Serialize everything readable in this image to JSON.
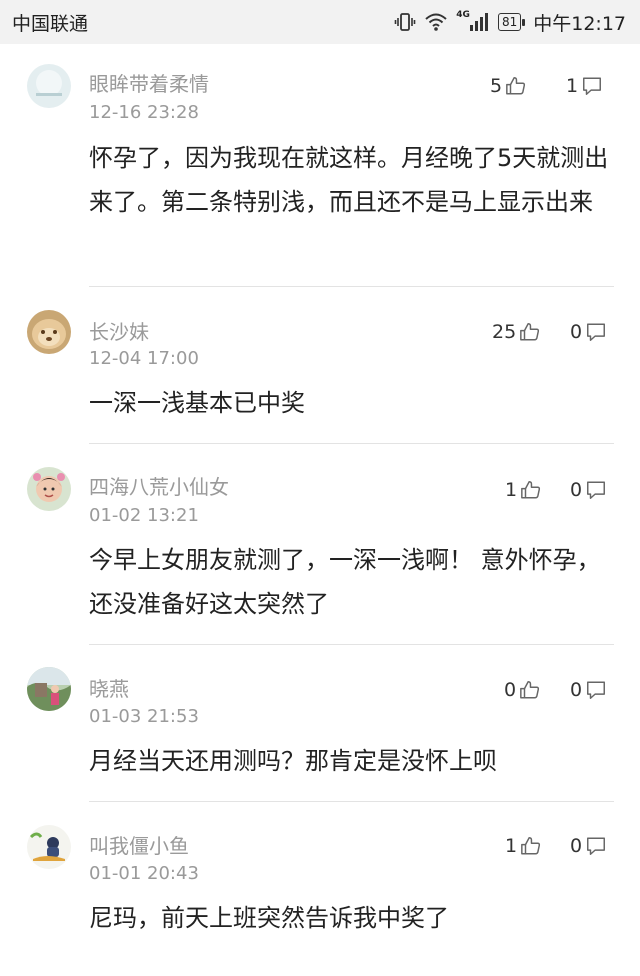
{
  "status": {
    "carrier": "中国联通",
    "network": "4G",
    "battery": "81",
    "time": "中午12:17"
  },
  "comments": [
    {
      "username": "眼眸带着柔情",
      "date": "12-16 23:28",
      "likes": "5",
      "replies": "1",
      "content": "怀孕了，因为我现在就这样。月经晚了5天就测出来了。第二条特别浅，而且还不是马上显示出来"
    },
    {
      "username": "长沙妹",
      "date": "12-04 17:00",
      "likes": "25",
      "replies": "0",
      "content": "一深一浅基本已中奖"
    },
    {
      "username": "四海八荒小仙女",
      "date": "01-02 13:21",
      "likes": "1",
      "replies": "0",
      "content": "今早上女朋友就测了，一深一浅啊！ 意外怀孕，还没准备好这太突然了"
    },
    {
      "username": "晓燕",
      "date": "01-03 21:53",
      "likes": "0",
      "replies": "0",
      "content": "月经当天还用测吗？那肯定是没怀上呗"
    },
    {
      "username": "叫我僵小鱼",
      "date": "01-01 20:43",
      "likes": "1",
      "replies": "0",
      "content": "尼玛，前天上班突然告诉我中奖了"
    }
  ]
}
